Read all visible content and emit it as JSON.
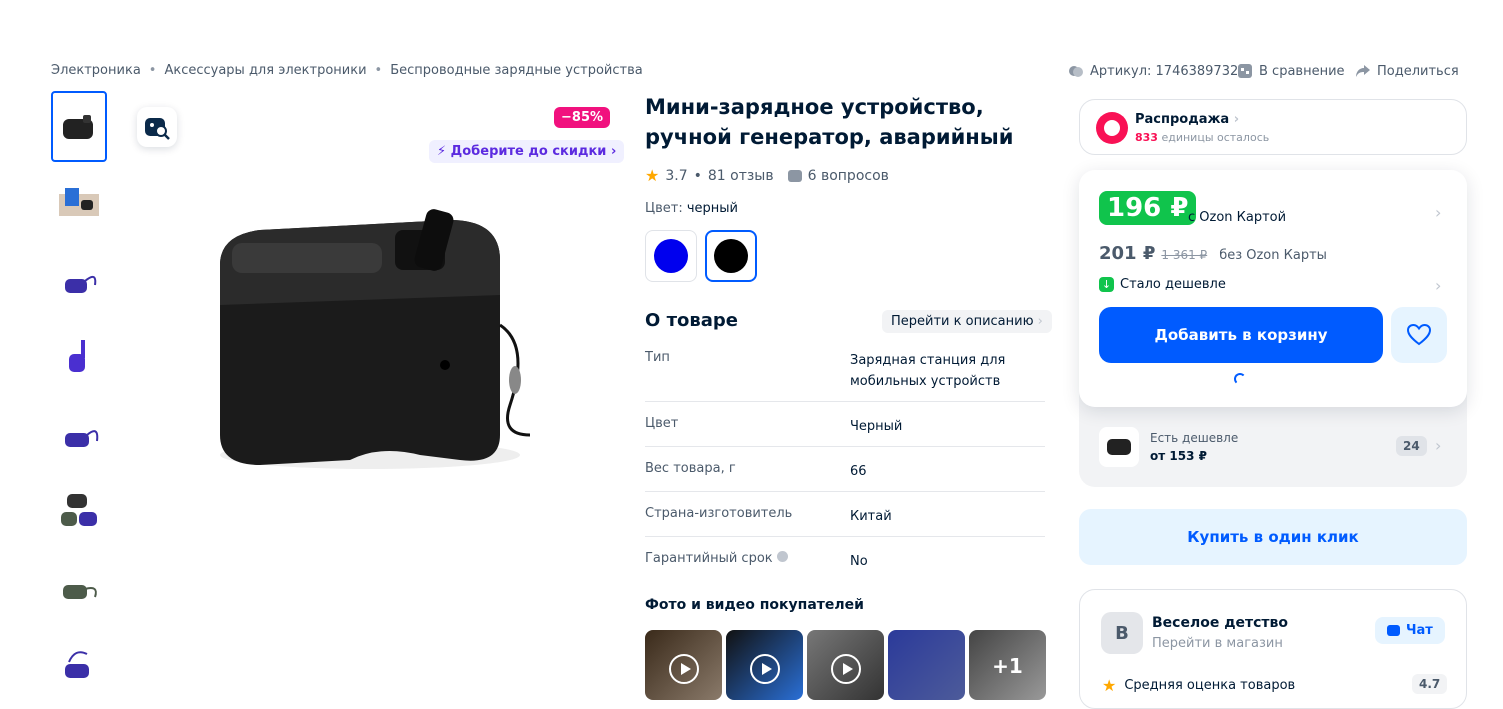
{
  "breadcrumbs": [
    "Электроника",
    "Аксессуары для электроники",
    "Беспроводные зарядные устройства"
  ],
  "breadcrumb_sep": "•",
  "top_actions": {
    "sku": "Артикул: 1746389732",
    "compare": "В сравнение",
    "share": "Поделиться"
  },
  "gallery": {
    "discount_badge": "−85%",
    "get_discount": "Доберите до скидки",
    "thumbnails": [
      "dynamo-black",
      "dynamo-in-hand",
      "dynamo-blue",
      "dynamo-blue-crank",
      "dynamo-blue-2",
      "dynamo-set",
      "dynamo-green",
      "dynamo-blue-3"
    ]
  },
  "product": {
    "title": "Мини-зарядное устройство, ручной генератор, аварийный",
    "rating": "3.7",
    "reviews": "81 отзыв",
    "rating_sep": "•",
    "questions": "6 вопросов",
    "color_label": "Цвет:",
    "color_value": "черный",
    "swatches": [
      "#0000ee",
      "#000000"
    ]
  },
  "about": {
    "heading": "О товаре",
    "goto_desc": "Перейти к описанию",
    "specs": [
      {
        "key": "Тип",
        "value": "Зарядная станция для мобильных устройств"
      },
      {
        "key": "Цвет",
        "value": "Черный"
      },
      {
        "key": "Вес товара, г",
        "value": "66"
      },
      {
        "key": "Страна-изготовитель",
        "value": "Китай"
      },
      {
        "key": "Гарантийный срок",
        "value": "No"
      }
    ]
  },
  "customer_photos": {
    "heading": "Фото и видео покупателей",
    "more": "+1"
  },
  "sale": {
    "label": "Распродажа",
    "left_count": "833",
    "left_text": "единицы осталось"
  },
  "price": {
    "card_price": "196 ₽",
    "card_label": "с Ozon Картой",
    "price": "201 ₽",
    "old_price": "1 361 ₽",
    "no_card_label": "без Ozon Карты",
    "cheaper_note": "Стало дешевле",
    "add_to_cart": "Добавить в корзину"
  },
  "cheaper_offer": {
    "label": "Есть дешевле",
    "from": "от 153 ₽",
    "count": "24"
  },
  "buy_one_click": "Купить в один клик",
  "seller": {
    "initial": "В",
    "name": "Веселое детство",
    "go_to_store": "Перейти в магазин",
    "chat": "Чат",
    "avg_rating_label": "Средняя оценка товаров",
    "avg_rating": "4.7"
  },
  "colors": {
    "accent": "#005bff",
    "discount": "#f1117e",
    "ozon_card_green": "#10c44c",
    "sale_pink": "#f91155"
  }
}
